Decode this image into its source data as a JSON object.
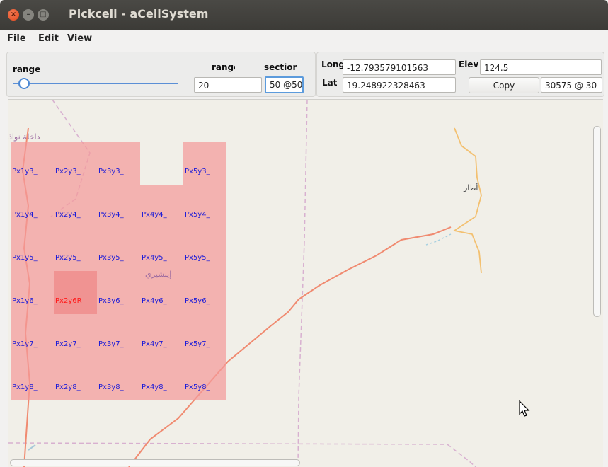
{
  "window": {
    "title": "Pickcell - aCellSystem",
    "controls": [
      "close-icon",
      "minimize-icon",
      "maximize-icon"
    ]
  },
  "menu": [
    "File",
    "Edit",
    "View"
  ],
  "controls": {
    "range_slider_label": "range",
    "range_slider_value": 0.06,
    "range_label": "range",
    "range_value": "20",
    "section_label": "section",
    "section_value": "50 @50"
  },
  "coords": {
    "long_label": "Long",
    "long_value": "-12.793579101563",
    "lat_label": "Lat",
    "lat_value": "19.248922328463",
    "elev_label": "Elev",
    "elev_value": "124.5",
    "copy_label": "Copy",
    "cell_value": "30575 @ 30"
  },
  "grid": {
    "cells": [
      [
        "Px1y3_",
        "Px2y3_",
        "Px3y3_",
        "",
        "Px5y3_"
      ],
      [
        "Px1y4_",
        "Px2y4_",
        "Px3y4_",
        "Px4y4_",
        "Px5y4_"
      ],
      [
        "Px1y5_",
        "Px2y5_",
        "Px3y5_",
        "Px4y5_",
        "Px5y5_"
      ],
      [
        "Px1y6_",
        "Px2y6R",
        "Px3y6_",
        "Px4y6_",
        "Px5y6_"
      ],
      [
        "Px1y7_",
        "Px2y7_",
        "Px3y7_",
        "Px4y7_",
        "Px5y7_"
      ],
      [
        "Px1y8_",
        "Px2y8_",
        "Px3y8_",
        "Px4y8_",
        "Px5y8_"
      ]
    ],
    "selected_cell": "Px2y6R",
    "cell_color": "#f49a9a",
    "label_color": "#1a1ad8",
    "selected_label_color": "#ff1a1a"
  },
  "map": {
    "places": [
      "داخلة نواذ",
      "إينشيري",
      "أطار"
    ],
    "road_color": "#f08060",
    "river_color": "#f0b860",
    "border_color": "#c8a0c8"
  }
}
